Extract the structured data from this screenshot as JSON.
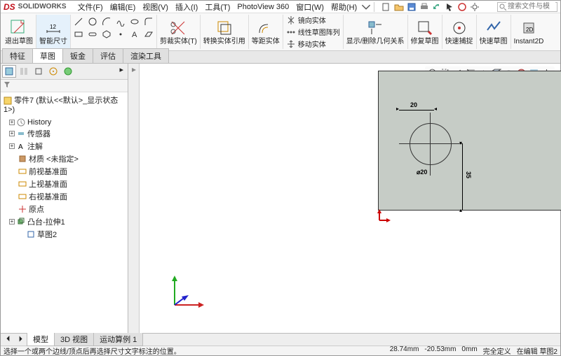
{
  "app": {
    "logo": "DS",
    "logo_sub": "SOLIDWORKS"
  },
  "menu": {
    "file": "文件(F)",
    "edit": "编辑(E)",
    "view": "视图(V)",
    "insert": "插入(I)",
    "tools": "工具(T)",
    "photoview": "PhotoView 360",
    "window": "窗口(W)",
    "help": "帮助(H)"
  },
  "search": {
    "placeholder": "搜索文件与模"
  },
  "ribbon": {
    "exit_sketch": "退出草图",
    "smart_dim": "智能尺寸",
    "trim": "剪裁实体(T)",
    "convert": "转换实体引用",
    "offset": "等距实体",
    "mirror": "镜向实体",
    "linear_pattern": "线性草图阵列",
    "move": "移动实体",
    "show_delete": "显示/删除几何关系",
    "repair": "修复草图",
    "quick_snap": "快速捕捉",
    "rapid": "快速草图",
    "instant": "Instant2D"
  },
  "feature_tabs": {
    "items": [
      "特征",
      "草图",
      "钣金",
      "评估",
      "渲染工具"
    ],
    "active": 1
  },
  "tree": {
    "title": "零件7 (默认<<默认>_显示状态 1>)",
    "nodes": [
      {
        "icon": "history",
        "label": "History",
        "exp": "+"
      },
      {
        "icon": "sensor",
        "label": "传感器",
        "exp": "+"
      },
      {
        "icon": "annot",
        "label": "注解",
        "exp": "+"
      },
      {
        "icon": "material",
        "label": "材质 <未指定>",
        "exp": ""
      },
      {
        "icon": "plane",
        "label": "前视基准面",
        "exp": ""
      },
      {
        "icon": "plane",
        "label": "上视基准面",
        "exp": ""
      },
      {
        "icon": "plane",
        "label": "右视基准面",
        "exp": ""
      },
      {
        "icon": "origin",
        "label": "原点",
        "exp": ""
      },
      {
        "icon": "feat",
        "label": "凸台-拉伸1",
        "exp": "+"
      },
      {
        "icon": "sketch",
        "label": "草图2",
        "exp": ""
      }
    ]
  },
  "dims": {
    "d1": "20",
    "d2": "⌀20",
    "d3": "35"
  },
  "bottom_tabs": {
    "items": [
      "模型",
      "3D 视图",
      "运动算例 1"
    ],
    "active": 0
  },
  "status": {
    "prompt": "选择一个或两个边线/顶点后再选择尺寸文字标注的位置。",
    "coord_x": "28.74mm",
    "coord_y": "-20.53mm",
    "coord_z": "0mm",
    "def": "完全定义",
    "mode": "在编辑 草图2"
  }
}
